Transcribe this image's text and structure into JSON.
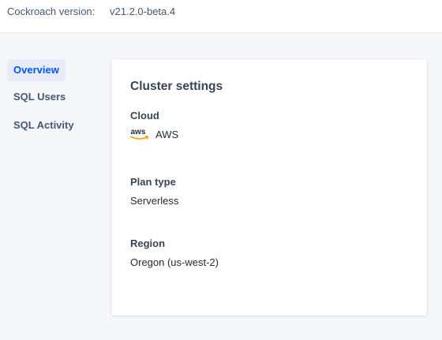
{
  "header": {
    "version_label": "Cockroach version:",
    "version_value": "v21.2.0-beta.4"
  },
  "sidebar": {
    "items": [
      {
        "label": "Overview",
        "active": true
      },
      {
        "label": "SQL Users",
        "active": false
      },
      {
        "label": "SQL Activity",
        "active": false
      }
    ]
  },
  "cluster_settings": {
    "title": "Cluster settings",
    "cloud": {
      "label": "Cloud",
      "logo_icon": "aws-logo-icon",
      "logo_text": "aws",
      "value": "AWS"
    },
    "plan_type": {
      "label": "Plan type",
      "value": "Serverless"
    },
    "region": {
      "label": "Region",
      "value": "Oregon (us-west-2)"
    }
  },
  "colors": {
    "accent": "#0055ff",
    "active_nav_bg": "#e7ecf7",
    "aws_orange": "#ff9900"
  }
}
